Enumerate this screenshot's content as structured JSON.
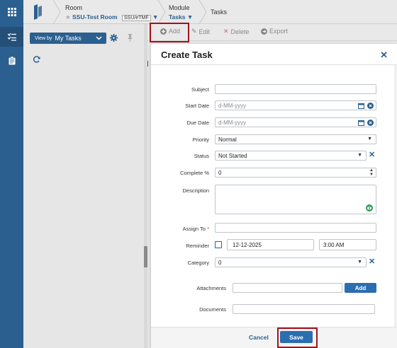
{
  "header": {
    "room_label": "Room",
    "room_value": "SSU-Test Room",
    "room_tag": "SSU/eTMF",
    "module_label": "Module",
    "module_value": "Tasks",
    "page_title": "Tasks"
  },
  "left_panel": {
    "view_by_small": "View by",
    "view_by_value": "My Tasks"
  },
  "toolbar": {
    "add": "Add",
    "edit": "Edit",
    "delete": "Delete",
    "export": "Export"
  },
  "modal": {
    "title": "Create Task",
    "fields": {
      "subject_label": "Subject",
      "subject_value": "",
      "start_label": "Start Date",
      "start_placeholder": "d-MM-yyyy",
      "due_label": "Due Date",
      "due_placeholder": "d-MM-yyyy",
      "priority_label": "Priority",
      "priority_value": "Normal",
      "status_label": "Status",
      "status_value": "Not Started",
      "complete_label": "Complete %",
      "complete_value": "0",
      "description_label": "Description",
      "assign_label": "Assign To",
      "assign_required": "*",
      "reminder_label": "Reminder",
      "reminder_date": "12-12-2025",
      "reminder_time": "3:00 AM",
      "category_label": "Category",
      "category_value": "0",
      "attachments_label": "Attachments",
      "attachments_add": "Add",
      "documents_label": "Documents"
    },
    "cancel": "Cancel",
    "save": "Save"
  },
  "colors": {
    "brand": "#2b5f8f",
    "accent_button": "#2b6eb0",
    "highlight": "#a3121a",
    "delete": "#c0392b"
  }
}
